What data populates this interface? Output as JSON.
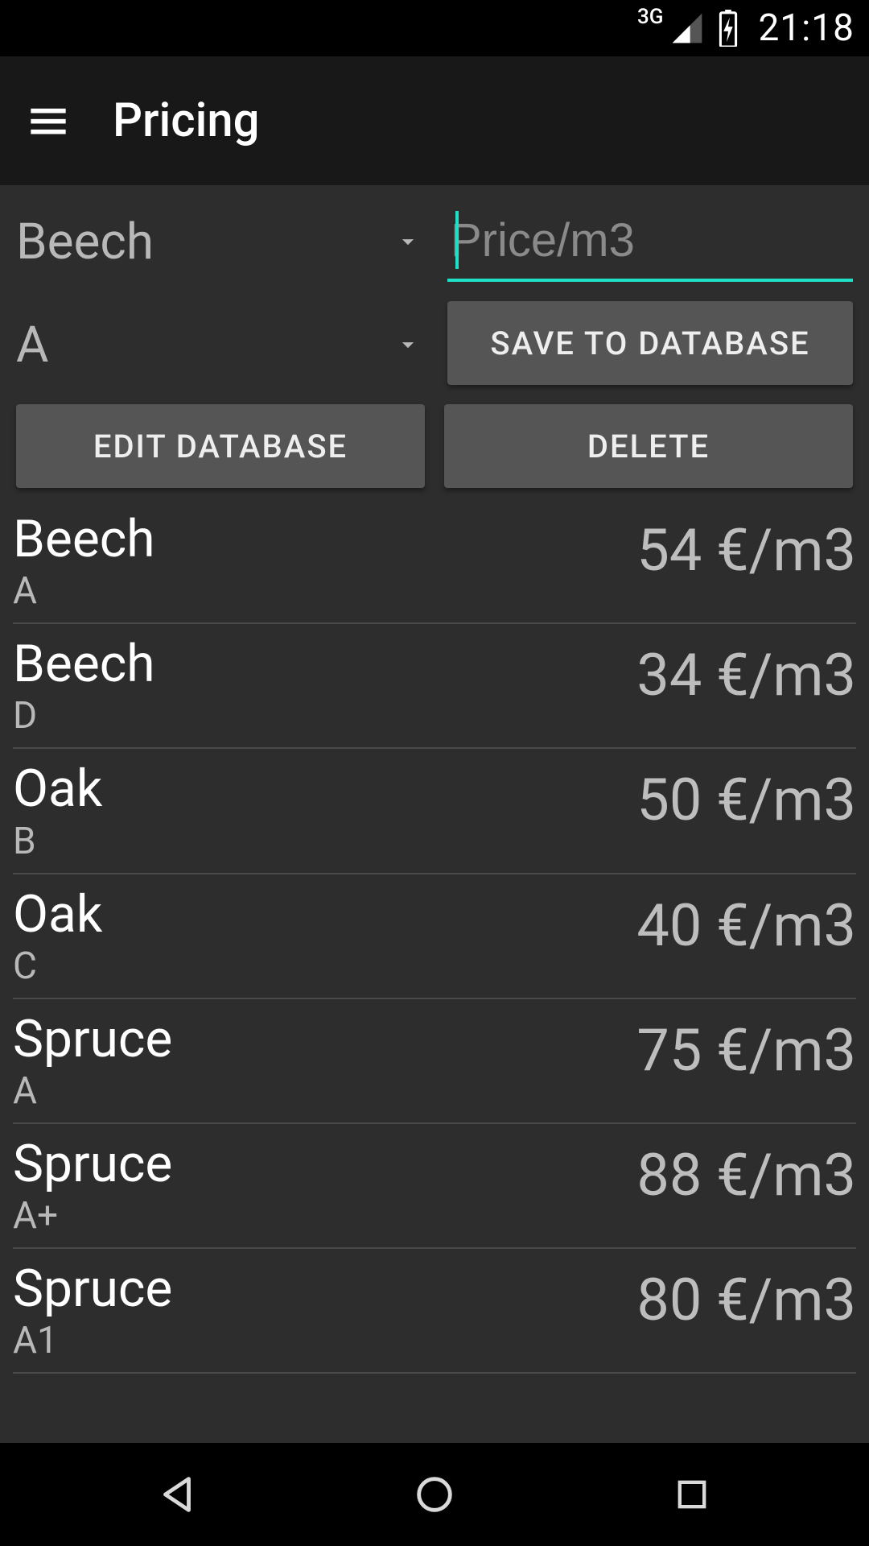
{
  "status": {
    "network_label": "3G",
    "time": "21:18"
  },
  "appbar": {
    "title": "Pricing"
  },
  "form": {
    "species_selected": "Beech",
    "grade_selected": "A",
    "price_placeholder": "Price/m3",
    "price_value": "",
    "save_label": "Save to database",
    "edit_label": "Edit database",
    "delete_label": "Delete"
  },
  "price_unit_suffix": " €/m3",
  "list": [
    {
      "species": "Beech",
      "grade": "A",
      "price": 54
    },
    {
      "species": "Beech",
      "grade": "D",
      "price": 34
    },
    {
      "species": "Oak",
      "grade": "B",
      "price": 50
    },
    {
      "species": "Oak",
      "grade": "C",
      "price": 40
    },
    {
      "species": "Spruce",
      "grade": "A",
      "price": 75
    },
    {
      "species": "Spruce",
      "grade": "A+",
      "price": 88
    },
    {
      "species": "Spruce",
      "grade": "A1",
      "price": 80
    }
  ]
}
